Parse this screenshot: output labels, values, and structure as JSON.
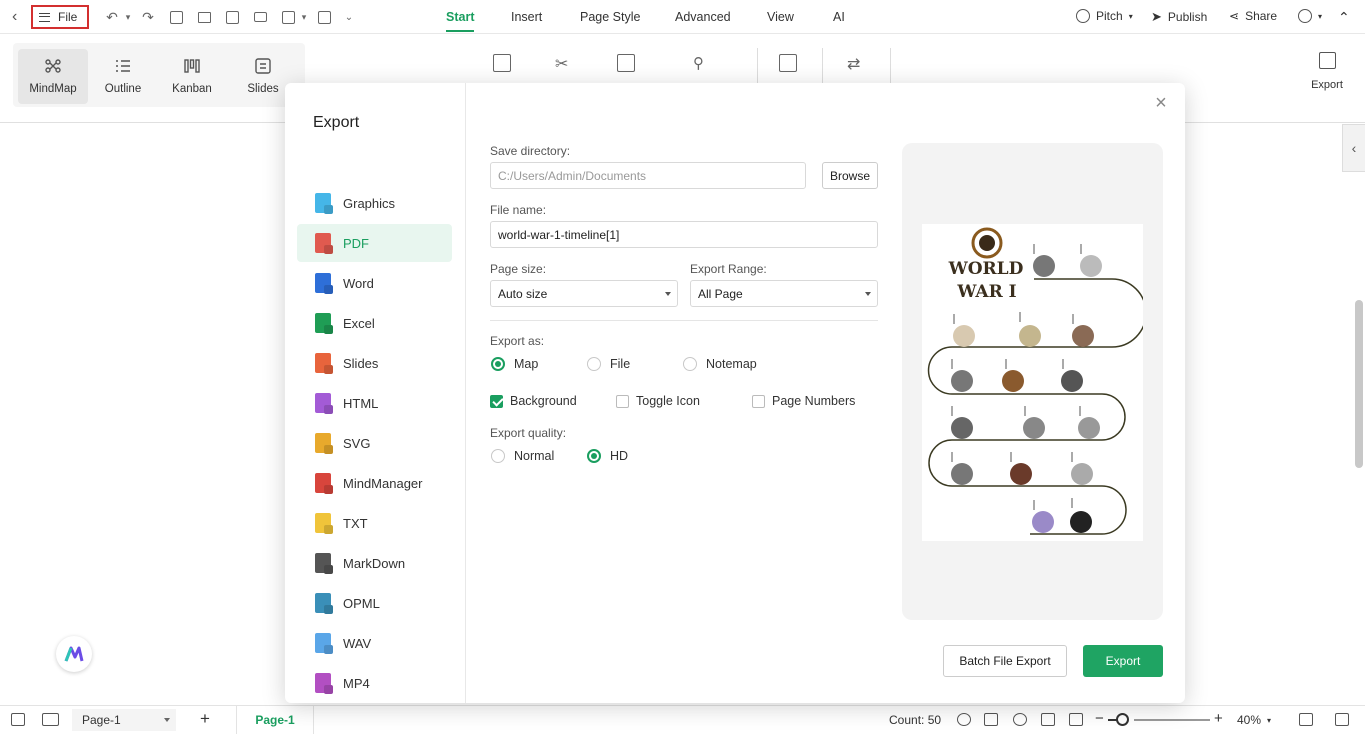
{
  "topbar": {
    "file_label": "File",
    "menu_tabs": [
      "Start",
      "Insert",
      "Page Style",
      "Advanced",
      "View",
      "AI"
    ],
    "active_tab": "Start",
    "pitch_label": "Pitch",
    "publish_label": "Publish",
    "share_label": "Share"
  },
  "ribbon": {
    "views": [
      "MindMap",
      "Outline",
      "Kanban",
      "Slides"
    ],
    "export_label": "Export"
  },
  "modal": {
    "title": "Export",
    "formats": [
      {
        "label": "Graphics",
        "color": "#45b6e8"
      },
      {
        "label": "PDF",
        "color": "#e05a4f"
      },
      {
        "label": "Word",
        "color": "#2e6fd8"
      },
      {
        "label": "Excel",
        "color": "#1f9d55"
      },
      {
        "label": "Slides",
        "color": "#e8643c"
      },
      {
        "label": "HTML",
        "color": "#a35bd6"
      },
      {
        "label": "SVG",
        "color": "#e8a92c"
      },
      {
        "label": "MindManager",
        "color": "#d8453c"
      },
      {
        "label": "TXT",
        "color": "#f0c43a"
      },
      {
        "label": "MarkDown",
        "color": "#555555"
      },
      {
        "label": "OPML",
        "color": "#3a8fb8"
      },
      {
        "label": "WAV",
        "color": "#5aa6e8"
      },
      {
        "label": "MP4",
        "color": "#b24fc2"
      }
    ],
    "active_format": "PDF",
    "save_directory_label": "Save directory:",
    "save_directory_placeholder": "C:/Users/Admin/Documents",
    "browse_label": "Browse",
    "file_name_label": "File name:",
    "file_name_value": "world-war-1-timeline[1]",
    "page_size_label": "Page size:",
    "page_size_value": "Auto size",
    "export_range_label": "Export Range:",
    "export_range_value": "All Page",
    "export_as_label": "Export as:",
    "export_as_options": [
      "Map",
      "File",
      "Notemap"
    ],
    "export_as_selected": "Map",
    "checkboxes": [
      {
        "label": "Background",
        "checked": true
      },
      {
        "label": "Toggle Icon",
        "checked": false
      },
      {
        "label": "Page Numbers",
        "checked": false
      }
    ],
    "export_quality_label": "Export quality:",
    "quality_options": [
      "Normal",
      "HD"
    ],
    "quality_selected": "HD",
    "preview_title_line1": "WORLD",
    "preview_title_line2": "WAR I",
    "batch_label": "Batch File Export",
    "export_button_label": "Export"
  },
  "statusbar": {
    "page_select": "Page-1",
    "page_tab": "Page-1",
    "count": "Count: 50",
    "zoom": "40%"
  },
  "colors": {
    "accent": "#1a9e5f",
    "file_highlight": "#d32f2f"
  }
}
